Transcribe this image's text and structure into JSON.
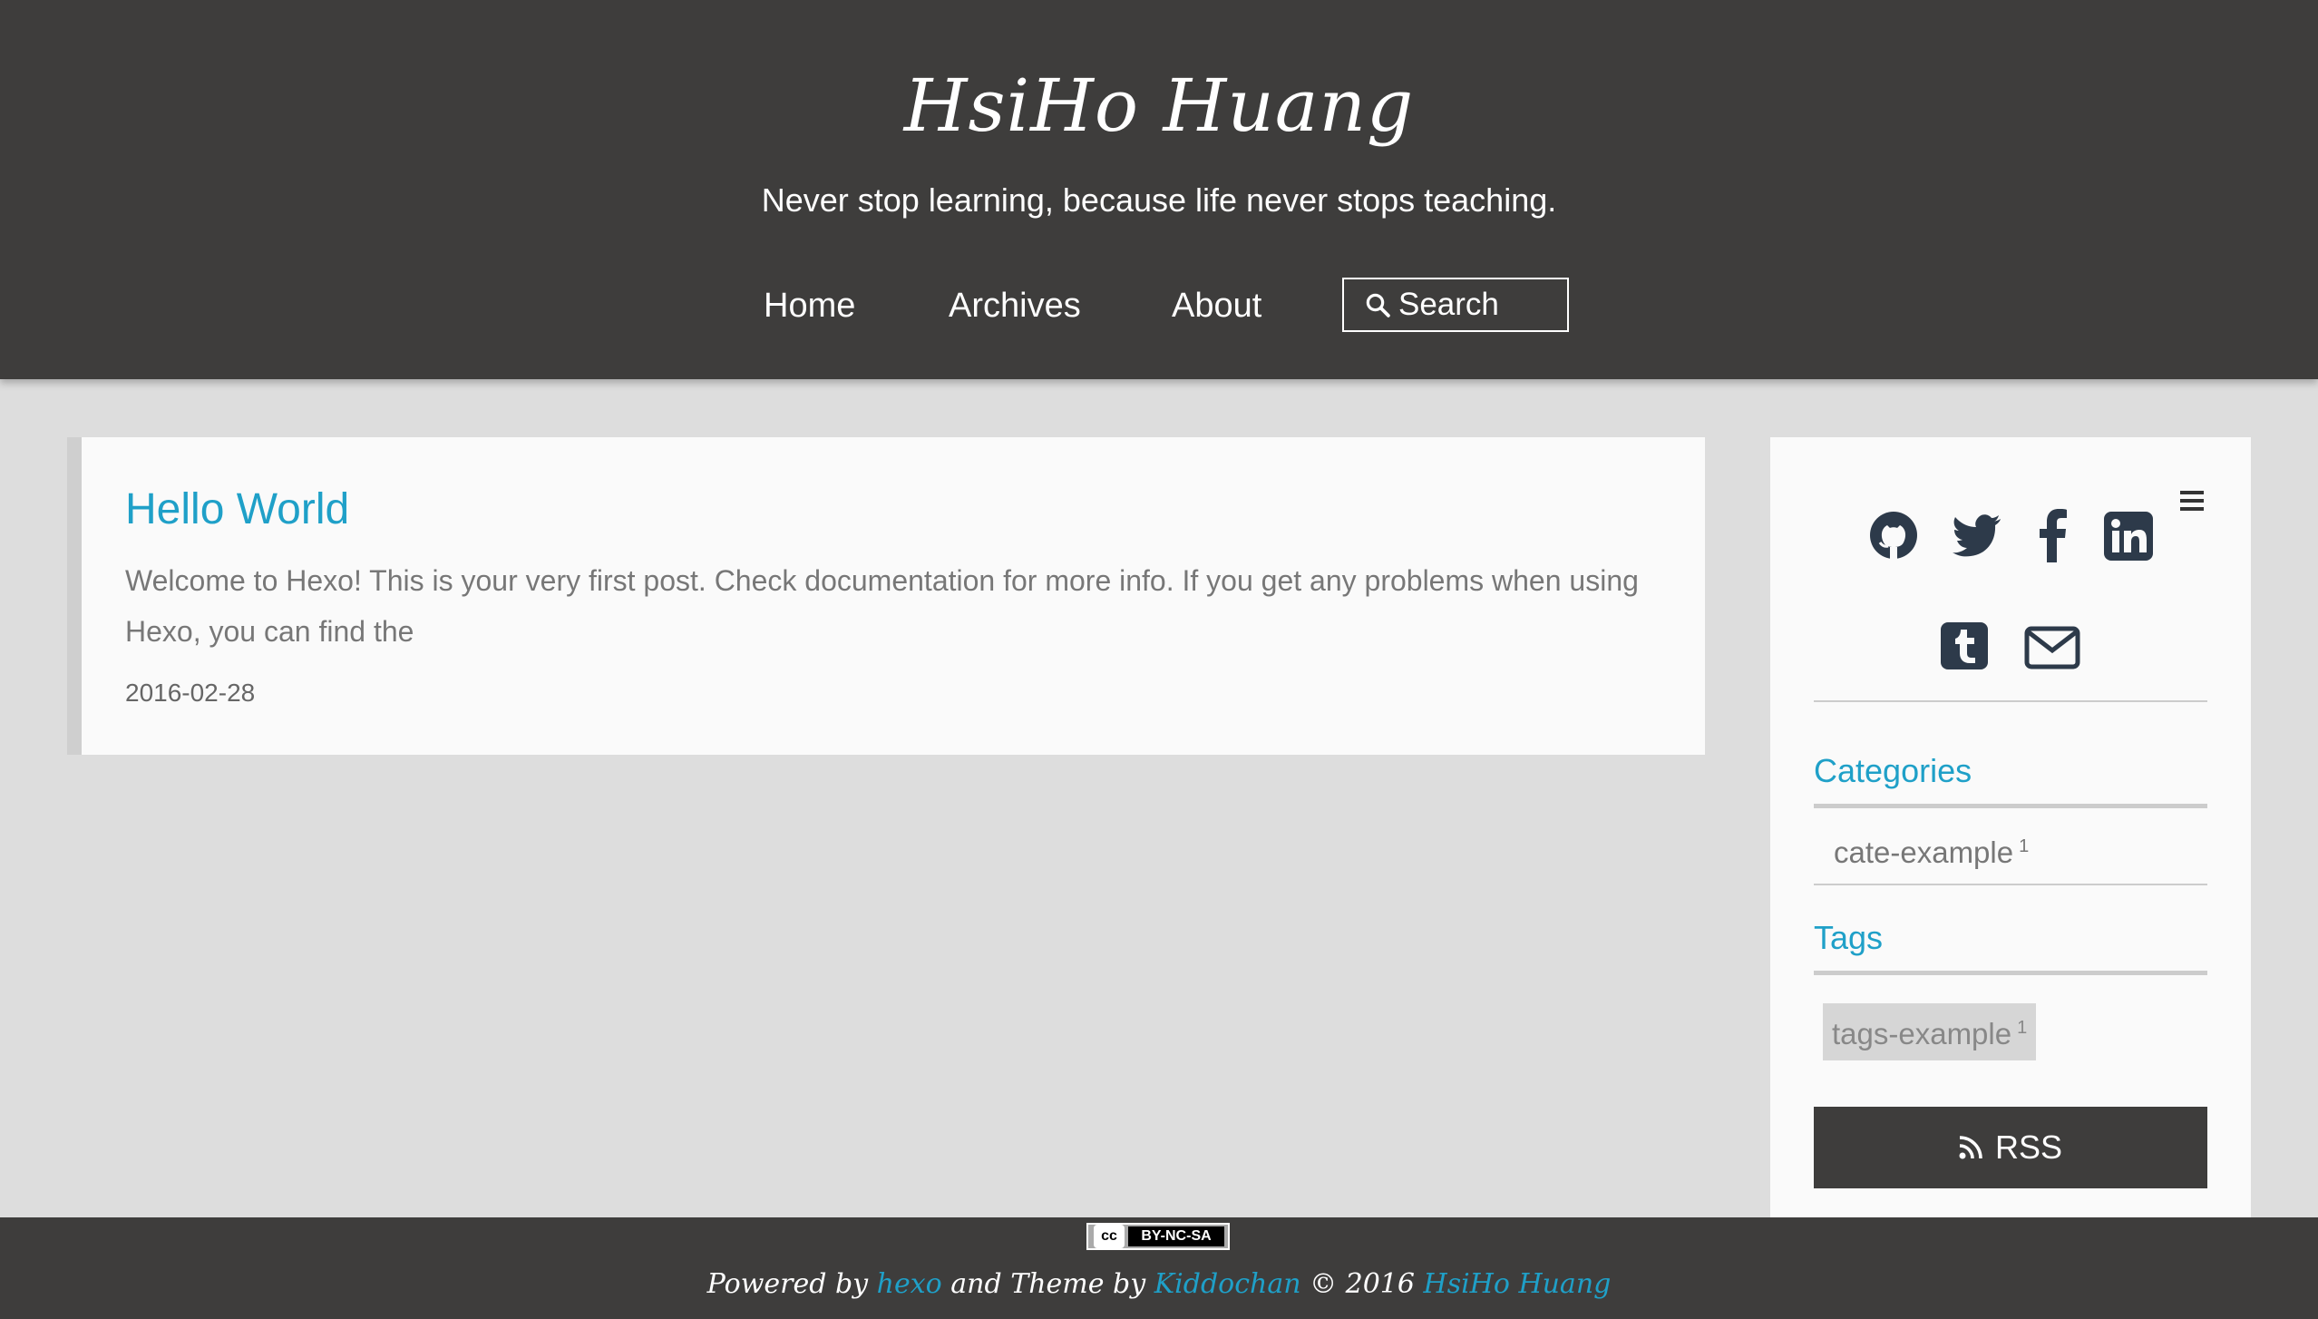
{
  "header": {
    "site_title": "HsiHo Huang",
    "subtitle": "Never stop learning, because life never stops teaching.",
    "nav": {
      "home": "Home",
      "archives": "Archives",
      "about": "About"
    },
    "search_label": "Search"
  },
  "post": {
    "title": "Hello World",
    "excerpt": "Welcome to Hexo! This is your very first post. Check documentation for more info. If you get any problems when using Hexo, you can find the",
    "date": "2016-02-28"
  },
  "sidebar": {
    "social_icons": [
      "github-icon",
      "twitter-icon",
      "facebook-icon",
      "linkedin-icon",
      "tumblr-icon",
      "mail-icon"
    ],
    "categories": {
      "heading": "Categories",
      "items": [
        {
          "name": "cate-example",
          "count": "1"
        }
      ]
    },
    "tags": {
      "heading": "Tags",
      "items": [
        {
          "name": "tags-example",
          "count": "1"
        }
      ]
    },
    "rss_label": "RSS"
  },
  "footer": {
    "license_badge": "BY-NC-SA",
    "license_logo": "cc",
    "powered_by": "Powered by",
    "hexo_link": "hexo",
    "theme_by": "and Theme by",
    "theme_link": "Kiddochan",
    "copyright": "© 2016",
    "author_link": "HsiHo Huang"
  },
  "colors": {
    "header_bg": "#3e3d3c",
    "page_bg": "#dddddd",
    "accent": "#1fa0c8",
    "icon": "#2d3a4a"
  }
}
